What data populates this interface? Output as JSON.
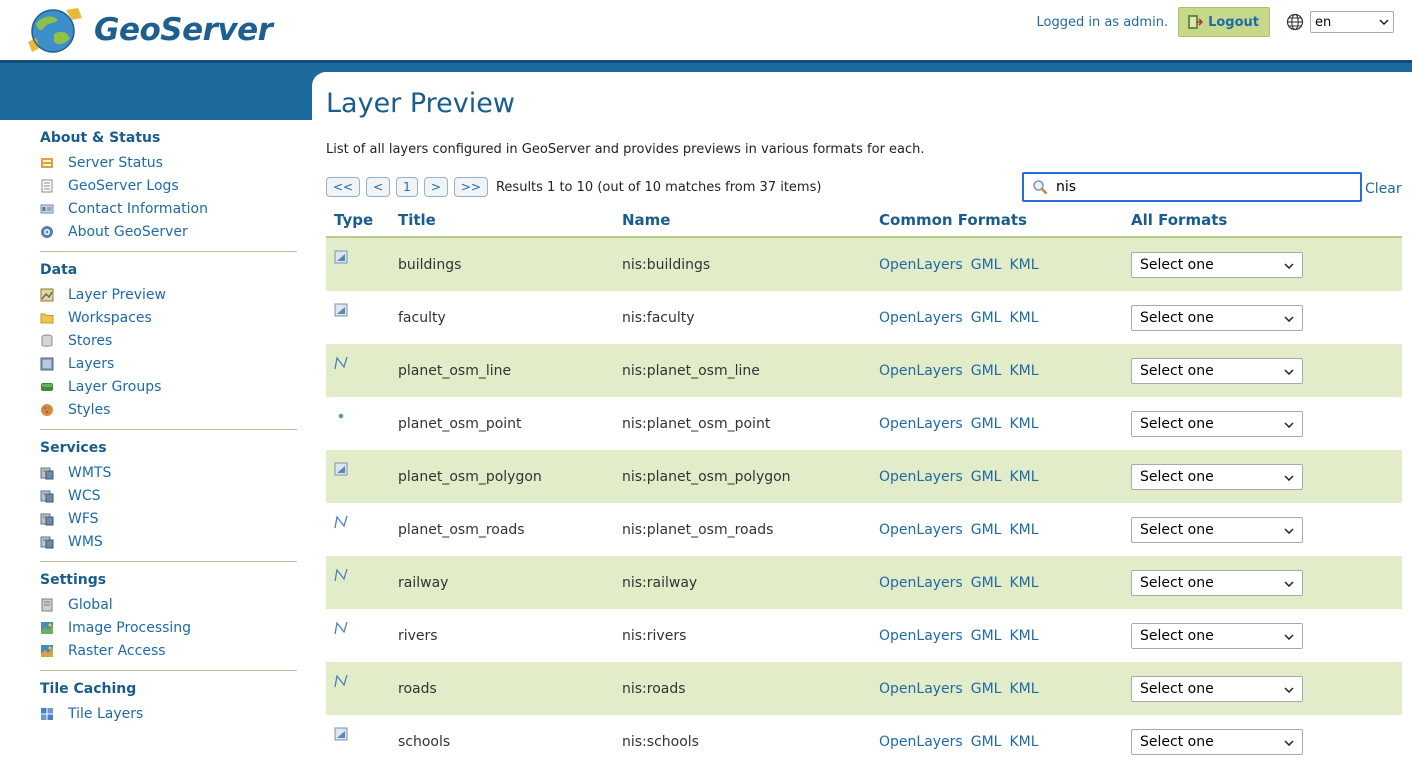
{
  "header": {
    "logo_text": "GeoServer",
    "logged_in_text": "Logged in as admin.",
    "logout_label": "Logout",
    "language": "en"
  },
  "sidebar": {
    "sections": [
      {
        "title": "About & Status",
        "items": [
          {
            "label": "Server Status",
            "icon": "server-status-icon"
          },
          {
            "label": "GeoServer Logs",
            "icon": "logs-icon"
          },
          {
            "label": "Contact Information",
            "icon": "contact-icon"
          },
          {
            "label": "About GeoServer",
            "icon": "about-icon"
          }
        ]
      },
      {
        "title": "Data",
        "items": [
          {
            "label": "Layer Preview",
            "icon": "layer-preview-icon"
          },
          {
            "label": "Workspaces",
            "icon": "folder-icon"
          },
          {
            "label": "Stores",
            "icon": "database-icon"
          },
          {
            "label": "Layers",
            "icon": "layers-icon"
          },
          {
            "label": "Layer Groups",
            "icon": "layer-groups-icon"
          },
          {
            "label": "Styles",
            "icon": "styles-icon"
          }
        ]
      },
      {
        "title": "Services",
        "items": [
          {
            "label": "WMTS",
            "icon": "service-icon"
          },
          {
            "label": "WCS",
            "icon": "service-icon"
          },
          {
            "label": "WFS",
            "icon": "service-icon"
          },
          {
            "label": "WMS",
            "icon": "service-icon"
          }
        ]
      },
      {
        "title": "Settings",
        "items": [
          {
            "label": "Global",
            "icon": "global-icon"
          },
          {
            "label": "Image Processing",
            "icon": "image-processing-icon"
          },
          {
            "label": "Raster Access",
            "icon": "raster-access-icon"
          }
        ]
      },
      {
        "title": "Tile Caching",
        "items": [
          {
            "label": "Tile Layers",
            "icon": "tile-layers-icon"
          }
        ]
      }
    ]
  },
  "main": {
    "title": "Layer Preview",
    "description": "List of all layers configured in GeoServer and provides previews in various formats for each.",
    "pager": {
      "first": "<<",
      "prev": "<",
      "page": "1",
      "next": ">",
      "last": ">>",
      "info": "Results 1 to 10 (out of 10 matches from 37 items)"
    },
    "search": {
      "value": "nis",
      "clear_label": "Clear"
    },
    "table": {
      "headers": {
        "type": "Type",
        "title": "Title",
        "name": "Name",
        "common": "Common Formats",
        "all": "All Formats"
      },
      "format_links": [
        "OpenLayers",
        "GML",
        "KML"
      ],
      "select_placeholder": "Select one",
      "rows": [
        {
          "type": "polygon",
          "title": "buildings",
          "name": "nis:buildings"
        },
        {
          "type": "polygon",
          "title": "faculty",
          "name": "nis:faculty"
        },
        {
          "type": "line",
          "title": "planet_osm_line",
          "name": "nis:planet_osm_line"
        },
        {
          "type": "point",
          "title": "planet_osm_point",
          "name": "nis:planet_osm_point"
        },
        {
          "type": "polygon",
          "title": "planet_osm_polygon",
          "name": "nis:planet_osm_polygon"
        },
        {
          "type": "line",
          "title": "planet_osm_roads",
          "name": "nis:planet_osm_roads"
        },
        {
          "type": "line",
          "title": "railway",
          "name": "nis:railway"
        },
        {
          "type": "line",
          "title": "rivers",
          "name": "nis:rivers"
        },
        {
          "type": "line",
          "title": "roads",
          "name": "nis:roads"
        },
        {
          "type": "polygon",
          "title": "schools",
          "name": "nis:schools"
        }
      ]
    }
  },
  "colors": {
    "band": "#1c6a9e",
    "link": "#1f6aa5",
    "row_alt": "#e3ecc9",
    "logout_bg": "#c6d98a"
  }
}
